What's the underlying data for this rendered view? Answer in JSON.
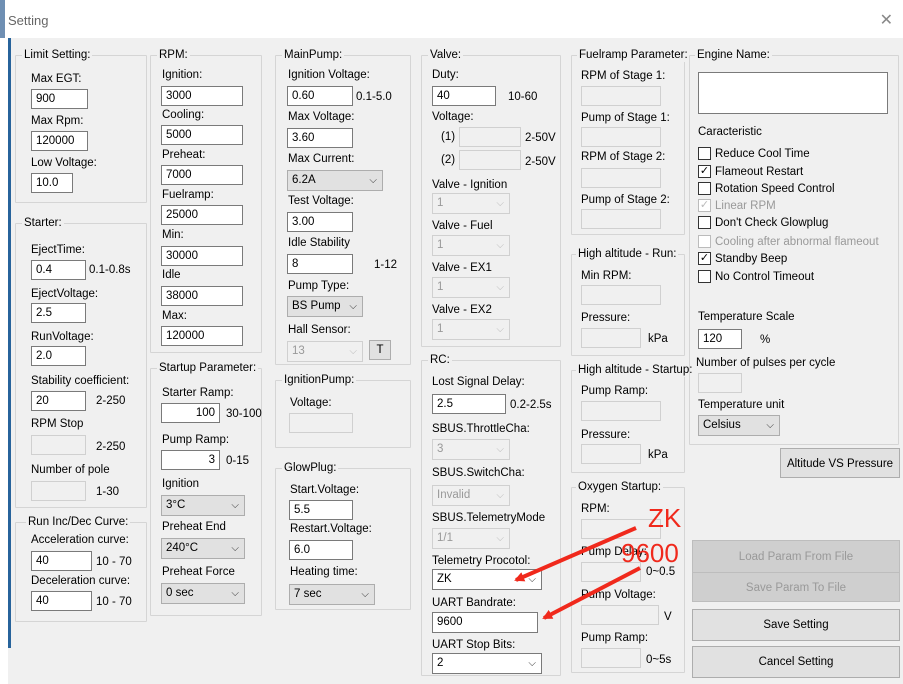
{
  "window": {
    "title": "Setting",
    "close_glyph": "✕"
  },
  "limit": {
    "title": "Limit Setting:",
    "max_egt_label": "Max EGT:",
    "max_egt": "900",
    "max_rpm_label": "Max Rpm:",
    "max_rpm": "120000",
    "low_voltage_label": "Low Voltage:",
    "low_voltage": "10.0"
  },
  "starter": {
    "title": "Starter:",
    "eject_time_label": "EjectTime:",
    "eject_time": "0.4",
    "eject_time_range": "0.1-0.8s",
    "eject_voltage_label": "EjectVoltage:",
    "eject_voltage": "2.5",
    "run_voltage_label": "RunVoltage:",
    "run_voltage": "2.0",
    "stability_label": "Stability coefficient:",
    "stability": "20",
    "stability_range": "2-250",
    "rpm_stop_label": "RPM Stop",
    "rpm_stop_range": "2-250",
    "pole_label": "Number of pole",
    "pole_range": "1-30"
  },
  "runinc": {
    "title": "Run Inc/Dec Curve:",
    "accel_label": "Acceleration curve:",
    "accel": "40",
    "accel_range": "10 - 70",
    "decel_label": "Deceleration curve:",
    "decel": "40",
    "decel_range": "10 - 70"
  },
  "rpm": {
    "title": "RPM:",
    "ignition_label": "Ignition:",
    "ignition": "3000",
    "cooling_label": "Cooling:",
    "cooling": "5000",
    "preheat_label": "Preheat:",
    "preheat": "7000",
    "fuelramp_label": "Fuelramp:",
    "fuelramp": "25000",
    "min_label": "Min:",
    "min": "30000",
    "idle_label": "Idle",
    "idle": "38000",
    "max_label": "Max:",
    "max": "120000"
  },
  "startup": {
    "title": "Startup Parameter:",
    "starter_ramp_label": "Starter Ramp:",
    "starter_ramp": "100",
    "starter_ramp_range": "30-100",
    "pump_ramp_label": "Pump Ramp:",
    "pump_ramp": "3",
    "pump_ramp_range": "0-15",
    "ignition_label": "Ignition",
    "ignition": "3°C",
    "preheat_end_label": "Preheat End",
    "preheat_end": "240°C",
    "preheat_force_label": "Preheat Force",
    "preheat_force": "0 sec"
  },
  "mainpump": {
    "title": "MainPump:",
    "ign_voltage_label": "Ignition Voltage:",
    "ign_voltage": "0.60",
    "ign_voltage_range": "0.1-5.0",
    "max_voltage_label": "Max Voltage:",
    "max_voltage": "3.60",
    "max_current_label": "Max Current:",
    "max_current": "6.2A",
    "test_voltage_label": "Test Voltage:",
    "test_voltage": "3.00",
    "idle_stability_label": "Idle Stability",
    "idle_stability": "8",
    "idle_stability_range": "1-12",
    "pump_type_label": "Pump Type:",
    "pump_type": "BS Pump",
    "hall_sensor_label": "Hall Sensor:",
    "hall_sensor": "13",
    "t_button": "T"
  },
  "ignpump": {
    "title": "IgnitionPump:",
    "voltage_label": "Voltage:"
  },
  "glowplug": {
    "title": "GlowPlug:",
    "start_voltage_label": "Start.Voltage:",
    "start_voltage": "5.5",
    "restart_voltage_label": "Restart.Voltage:",
    "restart_voltage": "6.0",
    "heating_label": "Heating time:",
    "heating": "7 sec"
  },
  "valve": {
    "title": "Valve:",
    "duty_label": "Duty:",
    "duty": "40",
    "duty_range": "10-60",
    "voltage_label": "Voltage:",
    "v1_label": "(1)",
    "v1_range": "2-50V",
    "v2_label": "(2)",
    "v2_range": "2-50V",
    "ignition_label": "Valve - Ignition",
    "ignition": "1",
    "fuel_label": "Valve - Fuel",
    "fuel": "1",
    "ex1_label": "Valve - EX1",
    "ex1": "1",
    "ex2_label": "Valve - EX2",
    "ex2": "1"
  },
  "rc": {
    "title": "RC:",
    "lost_signal_label": "Lost Signal Delay:",
    "lost_signal": "2.5",
    "lost_signal_range": "0.2-2.5s",
    "throttle_label": "SBUS.ThrottleCha:",
    "throttle": "3",
    "switch_label": "SBUS.SwitchCha:",
    "switch": "Invalid",
    "telemetry_mode_label": "SBUS.TelemetryMode",
    "telemetry_mode": "1/1",
    "telemetry_protocol_label": "Telemetry Procotol:",
    "telemetry_protocol": "ZK",
    "uart_baud_label": "UART Bandrate:",
    "uart_baud": "9600",
    "uart_stop_label": "UART Stop Bits:",
    "uart_stop": "2"
  },
  "fuelramp": {
    "title": "Fuelramp Parameter:",
    "rpm1_label": "RPM of Stage 1:",
    "pump1_label": "Pump of Stage 1:",
    "rpm2_label": "RPM of Stage 2:",
    "pump2_label": "Pump of Stage 2:"
  },
  "highrun": {
    "title": "High altitude - Run:",
    "min_rpm_label": "Min RPM:",
    "pressure_label": "Pressure:",
    "pressure_unit": "kPa"
  },
  "highstart": {
    "title": "High altitude - Startup:",
    "pump_ramp_label": "Pump Ramp:",
    "pressure_label": "Pressure:",
    "pressure_unit": "kPa"
  },
  "oxygen": {
    "title": "Oxygen Startup:",
    "rpm_label": "RPM:",
    "pump_delay_label": "Pump Delay:",
    "pump_delay_range": "0~0.5",
    "pump_voltage_label": "Pump Voltage:",
    "pump_voltage_unit": "V",
    "pump_ramp_label": "Pump Ramp:",
    "pump_ramp_range": "0~5s"
  },
  "engine": {
    "name_label": "Engine Name:"
  },
  "characteristic": {
    "title": "Caracteristic",
    "items": [
      {
        "label": "Reduce Cool Time",
        "checked": false,
        "disabled": false
      },
      {
        "label": "Flameout Restart",
        "checked": true,
        "disabled": false
      },
      {
        "label": "Rotation Speed Control",
        "checked": false,
        "disabled": false
      },
      {
        "label": "Linear RPM",
        "checked": true,
        "disabled": true
      },
      {
        "label": "Don't Check Glowplug",
        "checked": false,
        "disabled": false
      },
      {
        "label": "Cooling after abnormal flameout",
        "checked": false,
        "disabled": true
      },
      {
        "label": "Standby Beep",
        "checked": true,
        "disabled": false
      },
      {
        "label": "No Control Timeout",
        "checked": false,
        "disabled": false
      }
    ]
  },
  "temperature": {
    "scale_label": "Temperature Scale",
    "scale": "120",
    "scale_unit": "%",
    "pulses_label": "Number of pulses per cycle",
    "unit_label": "Temperature unit",
    "unit": "Celsius"
  },
  "buttons": {
    "altitude": "Altitude VS Pressure",
    "load": "Load Param From File",
    "save_file": "Save Param To File",
    "save": "Save Setting",
    "cancel": "Cancel Setting"
  },
  "annotations": {
    "zk": "ZK",
    "baud": "9600"
  },
  "colors": {
    "annotation": "#f0291c",
    "accent": "#27639b"
  }
}
